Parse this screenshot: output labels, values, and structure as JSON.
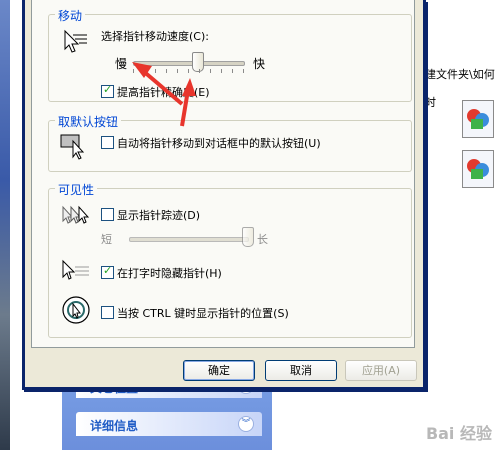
{
  "background": {
    "path_text": "建文件夹\\如何",
    "trail_text": "时",
    "dots": "."
  },
  "task_pane": {
    "items": [
      {
        "label": "其它位置"
      },
      {
        "label": "详细信息"
      }
    ]
  },
  "dialog": {
    "motion": {
      "title": "移动",
      "speed_label": "选择指针移动速度(C):",
      "slow": "慢",
      "fast": "快",
      "precision_label": "提高指针精确度(E)",
      "precision_checked": true,
      "speed_level": 0.58
    },
    "snap": {
      "title": "取默认按钮",
      "label": "自动将指针移动到对话框中的默认按钮(U)",
      "checked": false
    },
    "visibility": {
      "title": "可见性",
      "trails_label": "显示指针踪迹(D)",
      "trails_checked": false,
      "short": "短",
      "long": "长",
      "trails_level": 1.0,
      "hide_label": "在打字时隐藏指针(H)",
      "hide_checked": true,
      "ctrl_label": "当按 CTRL 键时显示指针的位置(S)",
      "ctrl_checked": false
    },
    "buttons": {
      "ok": "确定",
      "cancel": "取消",
      "apply": "应用(A)"
    }
  },
  "annotation_color": "#e8352c",
  "watermark": "Bai 经验"
}
